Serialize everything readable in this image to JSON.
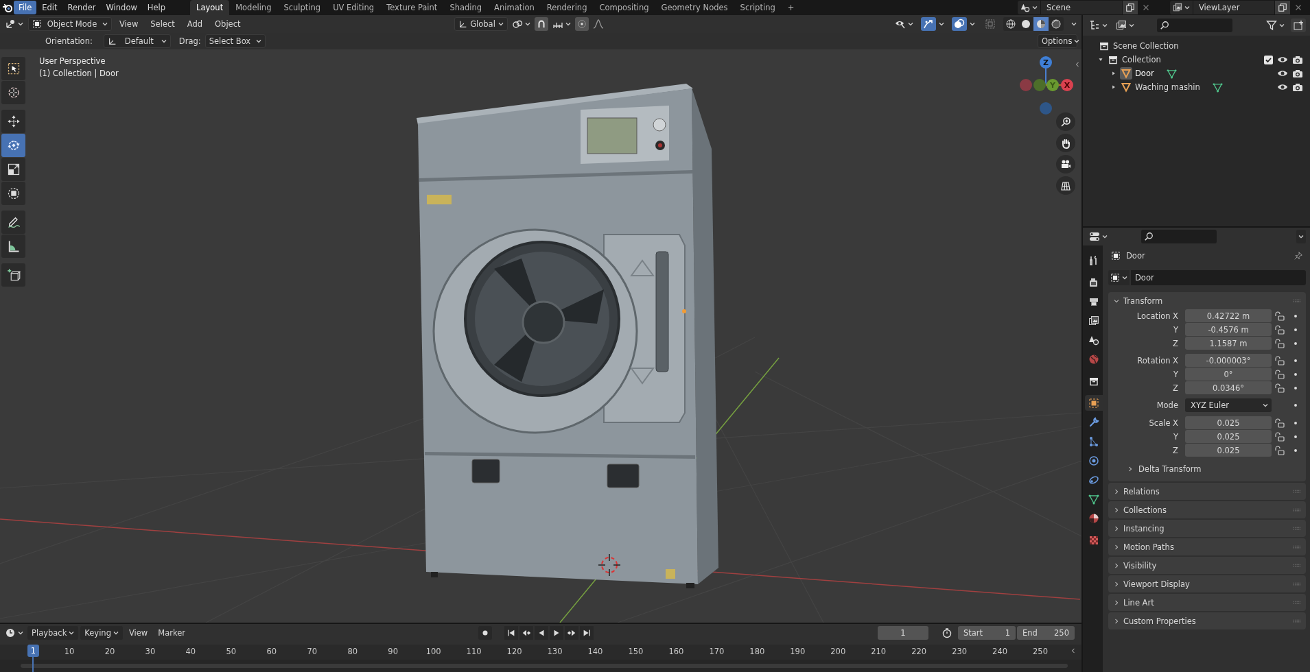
{
  "menu": [
    {
      "label": "File",
      "selected": true
    },
    {
      "label": "Edit",
      "selected": false
    },
    {
      "label": "Render",
      "selected": false
    },
    {
      "label": "Window",
      "selected": false
    },
    {
      "label": "Help",
      "selected": false
    }
  ],
  "workspaces": [
    {
      "label": "Layout",
      "selected": true
    },
    {
      "label": "Modeling",
      "selected": false
    },
    {
      "label": "Sculpting",
      "selected": false
    },
    {
      "label": "UV Editing",
      "selected": false
    },
    {
      "label": "Texture Paint",
      "selected": false
    },
    {
      "label": "Shading",
      "selected": false
    },
    {
      "label": "Animation",
      "selected": false
    },
    {
      "label": "Rendering",
      "selected": false
    },
    {
      "label": "Compositing",
      "selected": false
    },
    {
      "label": "Geometry Nodes",
      "selected": false
    },
    {
      "label": "Scripting",
      "selected": false
    }
  ],
  "add_workspace": "+",
  "scene": {
    "name": "Scene"
  },
  "view_layer": {
    "name": "ViewLayer"
  },
  "viewport": {
    "mode": "Object Mode",
    "menus": [
      "View",
      "Select",
      "Add",
      "Object"
    ],
    "orientation": "Global",
    "shading": [
      {
        "kind": "wireframe",
        "selected": false
      },
      {
        "kind": "solid",
        "selected": false
      },
      {
        "kind": "material",
        "selected": true
      },
      {
        "kind": "rendered",
        "selected": false
      }
    ],
    "options": "Options",
    "tool_settings": {
      "orientation_label": "Orientation:",
      "orientation": "Default",
      "drag_label": "Drag:",
      "drag": "Select Box"
    },
    "tool_groups": [
      {
        "tools": [
          {
            "kind": "select",
            "selected": false
          },
          {
            "kind": "cursor",
            "selected": false
          }
        ]
      },
      {
        "tools": [
          {
            "kind": "move",
            "selected": false
          },
          {
            "kind": "rotate",
            "selected": true
          },
          {
            "kind": "scale",
            "selected": false
          },
          {
            "kind": "transform",
            "selected": false
          }
        ]
      },
      {
        "tools": [
          {
            "kind": "annotate",
            "selected": false
          },
          {
            "kind": "measure",
            "selected": false
          }
        ]
      },
      {
        "tools": [
          {
            "kind": "add-cube",
            "selected": false
          }
        ]
      }
    ],
    "view_name": "User Perspective",
    "context": "(1) Collection | Door",
    "gizmo": {
      "z": "Z",
      "y": "Y",
      "x": "X"
    }
  },
  "outliner": {
    "items": [
      {
        "kind": "scene-collection",
        "label": "Scene Collection",
        "children": [
          {
            "kind": "collection",
            "label": "Collection",
            "expanded": true,
            "checked": true,
            "children": [
              {
                "kind": "mesh-object",
                "label": "Door",
                "expanded": false,
                "selected": true
              },
              {
                "kind": "mesh-object",
                "label": "Waching mashin",
                "expanded": false,
                "selected": false
              }
            ]
          }
        ]
      }
    ]
  },
  "properties": {
    "tab_groups": [
      {
        "tabs": [
          {
            "kind": "tool",
            "selected": false
          }
        ]
      },
      {
        "tabs": [
          {
            "kind": "render",
            "selected": false
          },
          {
            "kind": "output",
            "selected": false
          },
          {
            "kind": "view-layer",
            "selected": false
          },
          {
            "kind": "scene",
            "selected": false
          },
          {
            "kind": "world",
            "selected": false
          }
        ]
      },
      {
        "tabs": [
          {
            "kind": "collection",
            "selected": false
          }
        ]
      },
      {
        "tabs": [
          {
            "kind": "object",
            "selected": true
          },
          {
            "kind": "modifier",
            "selected": false
          },
          {
            "kind": "particles",
            "selected": false
          },
          {
            "kind": "physics",
            "selected": false
          },
          {
            "kind": "constraints",
            "selected": false
          },
          {
            "kind": "data",
            "selected": false
          },
          {
            "kind": "material",
            "selected": false
          }
        ]
      },
      {
        "tabs": [
          {
            "kind": "texture",
            "selected": false
          }
        ]
      }
    ],
    "object_name": "Door",
    "name_field": "Door",
    "transform": {
      "title": "Transform",
      "expanded": true,
      "groups": [
        {
          "rows": [
            {
              "kind": "number",
              "label": "Location X",
              "value": "0.42722 m"
            },
            {
              "kind": "number",
              "label": "Y",
              "value": "-0.4576 m"
            },
            {
              "kind": "number",
              "label": "Z",
              "value": "1.1587 m"
            }
          ]
        },
        {
          "rows": [
            {
              "kind": "number",
              "label": "Rotation X",
              "value": "-0.000003°"
            },
            {
              "kind": "number",
              "label": "Y",
              "value": "0°"
            },
            {
              "kind": "number",
              "label": "Z",
              "value": "0.0346°"
            }
          ]
        },
        {
          "rows": [
            {
              "kind": "dropdown",
              "label": "Mode",
              "value": "XYZ Euler"
            }
          ]
        },
        {
          "rows": [
            {
              "kind": "number",
              "label": "Scale X",
              "value": "0.025"
            },
            {
              "kind": "number",
              "label": "Y",
              "value": "0.025"
            },
            {
              "kind": "number",
              "label": "Z",
              "value": "0.025"
            }
          ]
        }
      ],
      "subpanels": [
        {
          "title": "Delta Transform",
          "expanded": false
        }
      ]
    },
    "panels": [
      {
        "title": "Relations",
        "expanded": false
      },
      {
        "title": "Collections",
        "expanded": false
      },
      {
        "title": "Instancing",
        "expanded": false
      },
      {
        "title": "Motion Paths",
        "expanded": false
      },
      {
        "title": "Visibility",
        "expanded": false
      },
      {
        "title": "Viewport Display",
        "expanded": false
      },
      {
        "title": "Line Art",
        "expanded": false
      },
      {
        "title": "Custom Properties",
        "expanded": false
      }
    ]
  },
  "timeline": {
    "menus": [
      {
        "kind": "dropdown",
        "label": "Playback"
      },
      {
        "kind": "dropdown",
        "label": "Keying"
      },
      {
        "kind": "menu",
        "label": "View"
      },
      {
        "kind": "menu",
        "label": "Marker"
      }
    ],
    "current_frame": "1",
    "start_label": "Start",
    "start": "1",
    "end_label": "End",
    "end": "250",
    "playhead": "1",
    "ruler": [
      "10",
      "20",
      "30",
      "40",
      "50",
      "60",
      "70",
      "80",
      "90",
      "100",
      "110",
      "120",
      "130",
      "140",
      "150",
      "160",
      "170",
      "180",
      "190",
      "200",
      "210",
      "220",
      "230",
      "240",
      "250"
    ]
  }
}
